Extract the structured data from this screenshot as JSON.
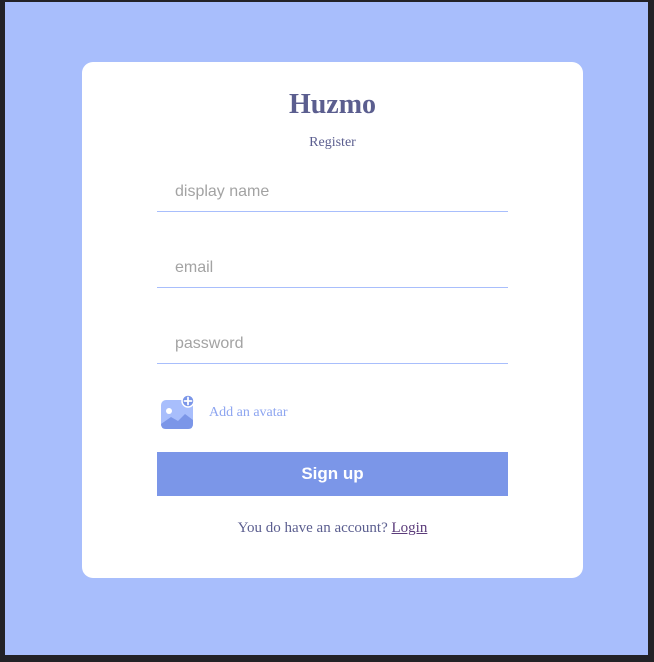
{
  "app": {
    "logo": "Huzmo",
    "subtitle": "Register"
  },
  "form": {
    "display_name_placeholder": "display name",
    "email_placeholder": "email",
    "password_placeholder": "password",
    "avatar_label": "Add an avatar",
    "avatar_icon": "add-image-icon",
    "submit_label": "Sign up"
  },
  "footer": {
    "text": "You do have an account? ",
    "login_label": "Login"
  },
  "colors": {
    "page_background": "#a8befc",
    "card_background": "#ffffff",
    "accent": "#7b96e8",
    "text": "#5b5e8f"
  }
}
